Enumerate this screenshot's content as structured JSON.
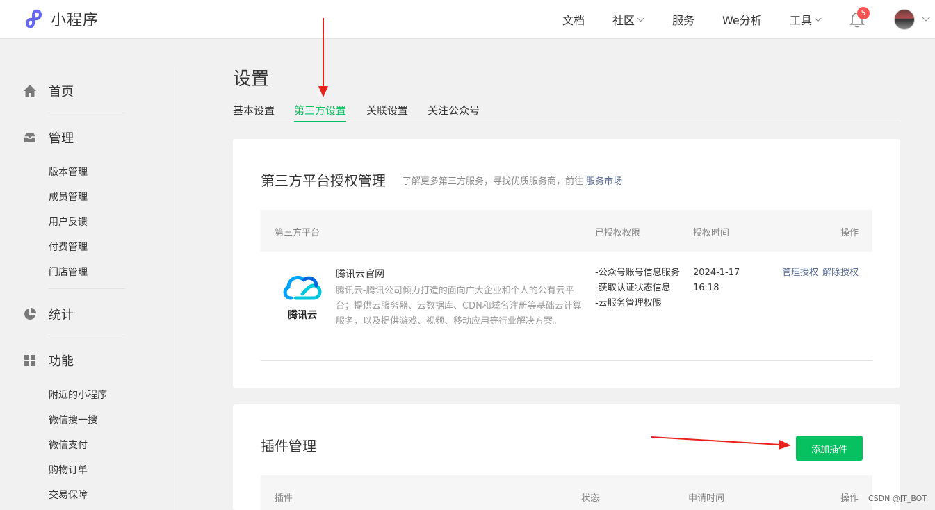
{
  "header": {
    "app_name": "小程序",
    "nav": [
      {
        "label": "文档",
        "has_dropdown": false
      },
      {
        "label": "社区",
        "has_dropdown": true
      },
      {
        "label": "服务",
        "has_dropdown": false
      },
      {
        "label": "We分析",
        "has_dropdown": false
      },
      {
        "label": "工具",
        "has_dropdown": true
      }
    ],
    "notification_count": "5",
    "logo_color": "#6467f0"
  },
  "sidebar": {
    "groups": [
      {
        "label": "首页",
        "icon": "home-icon",
        "items": []
      },
      {
        "label": "管理",
        "icon": "inbox-icon",
        "items": [
          "版本管理",
          "成员管理",
          "用户反馈",
          "付费管理",
          "门店管理"
        ]
      },
      {
        "label": "统计",
        "icon": "pie-chart-icon",
        "items": []
      },
      {
        "label": "功能",
        "icon": "grid-icon",
        "items": [
          "附近的小程序",
          "微信搜一搜",
          "微信支付",
          "购物订单",
          "交易保障"
        ]
      }
    ]
  },
  "main": {
    "title": "设置",
    "tabs": [
      {
        "label": "基本设置",
        "active": false
      },
      {
        "label": "第三方设置",
        "active": true
      },
      {
        "label": "关联设置",
        "active": false
      },
      {
        "label": "关注公众号",
        "active": false
      }
    ],
    "third_party": {
      "title": "第三方平台授权管理",
      "desc": "了解更多第三方服务，寻找优质服务商，前往",
      "desc_link": "服务市场",
      "columns": [
        "第三方平台",
        "已授权权限",
        "授权时间",
        "操作"
      ],
      "rows": [
        {
          "logo_text": "腾讯云",
          "name": "腾讯云官网",
          "desc": "腾讯云-腾讯公司倾力打造的面向广大企业和个人的公有云平台；提供云服务器、云数据库、CDN和域名注册等基础云计算服务，以及提供游戏、视频、移动应用等行业解决方案。",
          "permissions": [
            "-公众号账号信息服务",
            "-获取认证状态信息",
            "-云服务管理权限"
          ],
          "auth_time": "2024-1-17 16:18",
          "actions": [
            "管理授权",
            "解除授权"
          ]
        }
      ]
    },
    "plugins": {
      "title": "插件管理",
      "add_button": "添加插件",
      "columns": [
        "插件",
        "状态",
        "申请时间",
        "操作"
      ]
    }
  },
  "watermark": "CSDN @JT_BOT",
  "colors": {
    "accent": "#07c160",
    "link": "#576b95",
    "annotation_arrow": "#e8231c"
  }
}
